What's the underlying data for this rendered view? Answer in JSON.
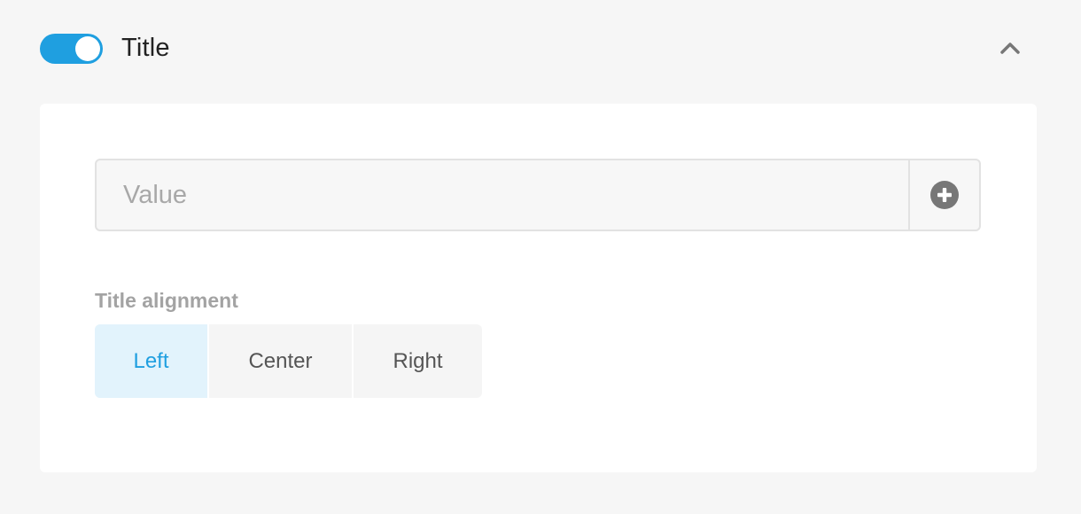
{
  "header": {
    "toggle_state": "on",
    "title": "Title",
    "collapse_icon": "chevron-up-icon"
  },
  "value_field": {
    "placeholder": "Value",
    "value": "",
    "add_icon": "plus-circle-icon"
  },
  "alignment": {
    "label": "Title alignment",
    "options": [
      "Left",
      "Center",
      "Right"
    ],
    "selected": "Left"
  },
  "colors": {
    "accent": "#1f9fe0",
    "accent_light": "#e2f3fc",
    "background": "#f6f6f6",
    "panel": "#ffffff",
    "icon_gray": "#777777"
  }
}
